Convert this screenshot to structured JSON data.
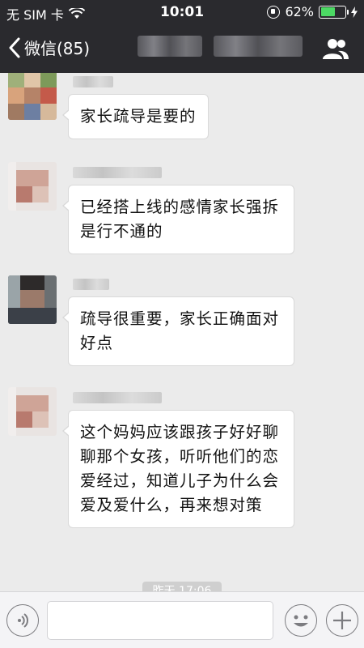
{
  "status_bar": {
    "carrier": "无 SIM 卡",
    "time": "10:01",
    "battery_percent": "62%",
    "battery_level": 0.62
  },
  "nav": {
    "back_label": "微信(85)"
  },
  "messages": [
    {
      "text": "家长疏导是要的"
    },
    {
      "text": "已经搭上线的感情家长强拆是行不通的"
    },
    {
      "text": "疏导很重要，家长正确面对好点"
    },
    {
      "text": "这个妈妈应该跟孩子好好聊聊那个女孩，听听他们的恋爱经过，知道儿子为什么会爱及爱什么，再来想对策"
    }
  ],
  "timestamp": "昨天 17:06",
  "input": {
    "placeholder": ""
  },
  "colors": {
    "bar_bg": "#2a2a2e",
    "chat_bg": "#ebebeb",
    "battery": "#4cd964"
  }
}
